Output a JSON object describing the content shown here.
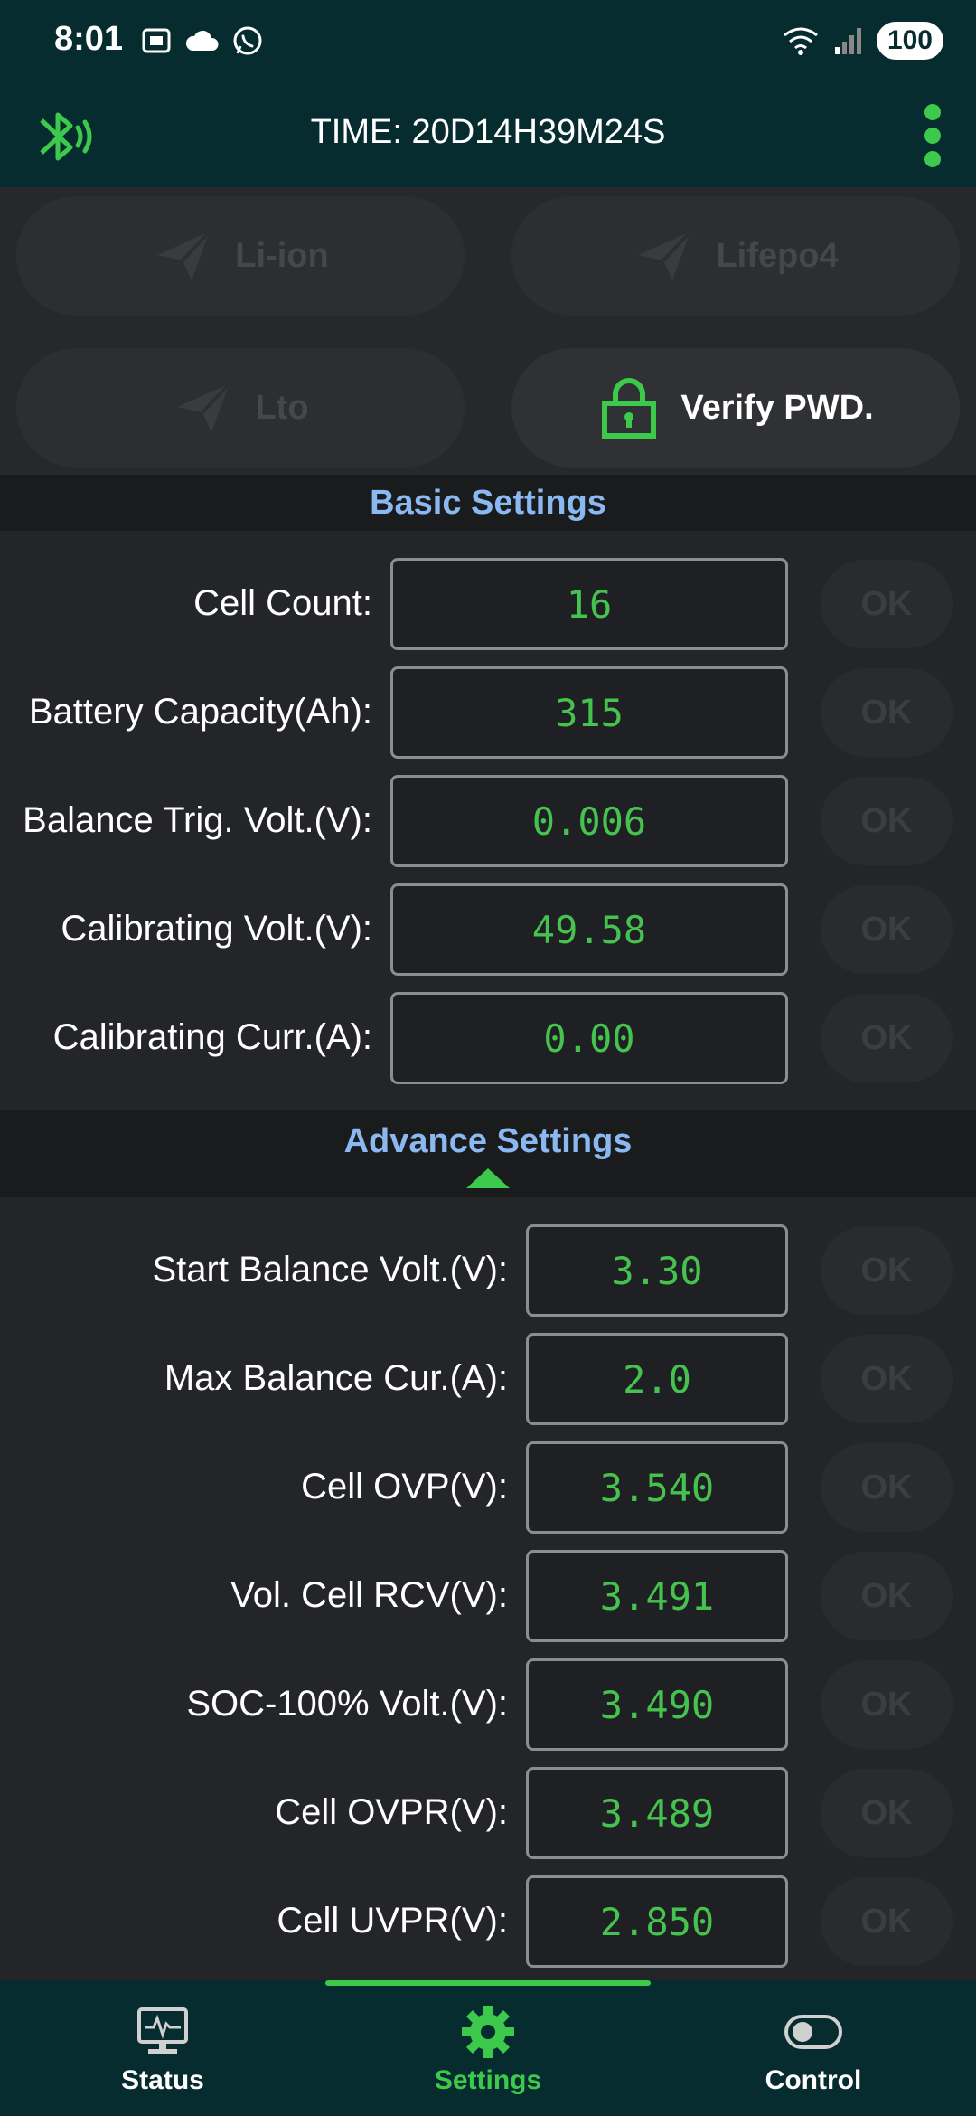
{
  "status_bar": {
    "time": "8:01",
    "battery": "100"
  },
  "header": {
    "title": "TIME: 20D14H39M24S"
  },
  "presets": {
    "li_ion": "Li-ion",
    "lifepo4": "Lifepo4",
    "lto": "Lto",
    "verify": "Verify PWD."
  },
  "basic_settings": {
    "title": "Basic Settings",
    "rows": [
      {
        "label": "Cell Count:",
        "value": "16",
        "ok": "OK"
      },
      {
        "label": "Battery Capacity(Ah):",
        "value": "315",
        "ok": "OK"
      },
      {
        "label": "Balance Trig. Volt.(V):",
        "value": "0.006",
        "ok": "OK"
      },
      {
        "label": "Calibrating Volt.(V):",
        "value": "49.58",
        "ok": "OK"
      },
      {
        "label": "Calibrating Curr.(A):",
        "value": "0.00",
        "ok": "OK"
      }
    ]
  },
  "advance_settings": {
    "title": "Advance Settings",
    "rows": [
      {
        "label": "Start Balance Volt.(V):",
        "value": "3.30",
        "ok": "OK"
      },
      {
        "label": "Max Balance Cur.(A):",
        "value": "2.0",
        "ok": "OK"
      },
      {
        "label": "Cell OVP(V):",
        "value": "3.540",
        "ok": "OK"
      },
      {
        "label": "Vol. Cell RCV(V):",
        "value": "3.491",
        "ok": "OK"
      },
      {
        "label": "SOC-100% Volt.(V):",
        "value": "3.490",
        "ok": "OK"
      },
      {
        "label": "Cell OVPR(V):",
        "value": "3.489",
        "ok": "OK"
      },
      {
        "label": "Cell UVPR(V):",
        "value": "2.850",
        "ok": "OK"
      }
    ]
  },
  "bottom_nav": {
    "status": "Status",
    "settings": "Settings",
    "control": "Control",
    "active": "settings"
  },
  "colors": {
    "accent": "#3cc94c",
    "header_bg": "#062c30",
    "section_title": "#8ab8f0",
    "value_text": "#46c24f"
  }
}
